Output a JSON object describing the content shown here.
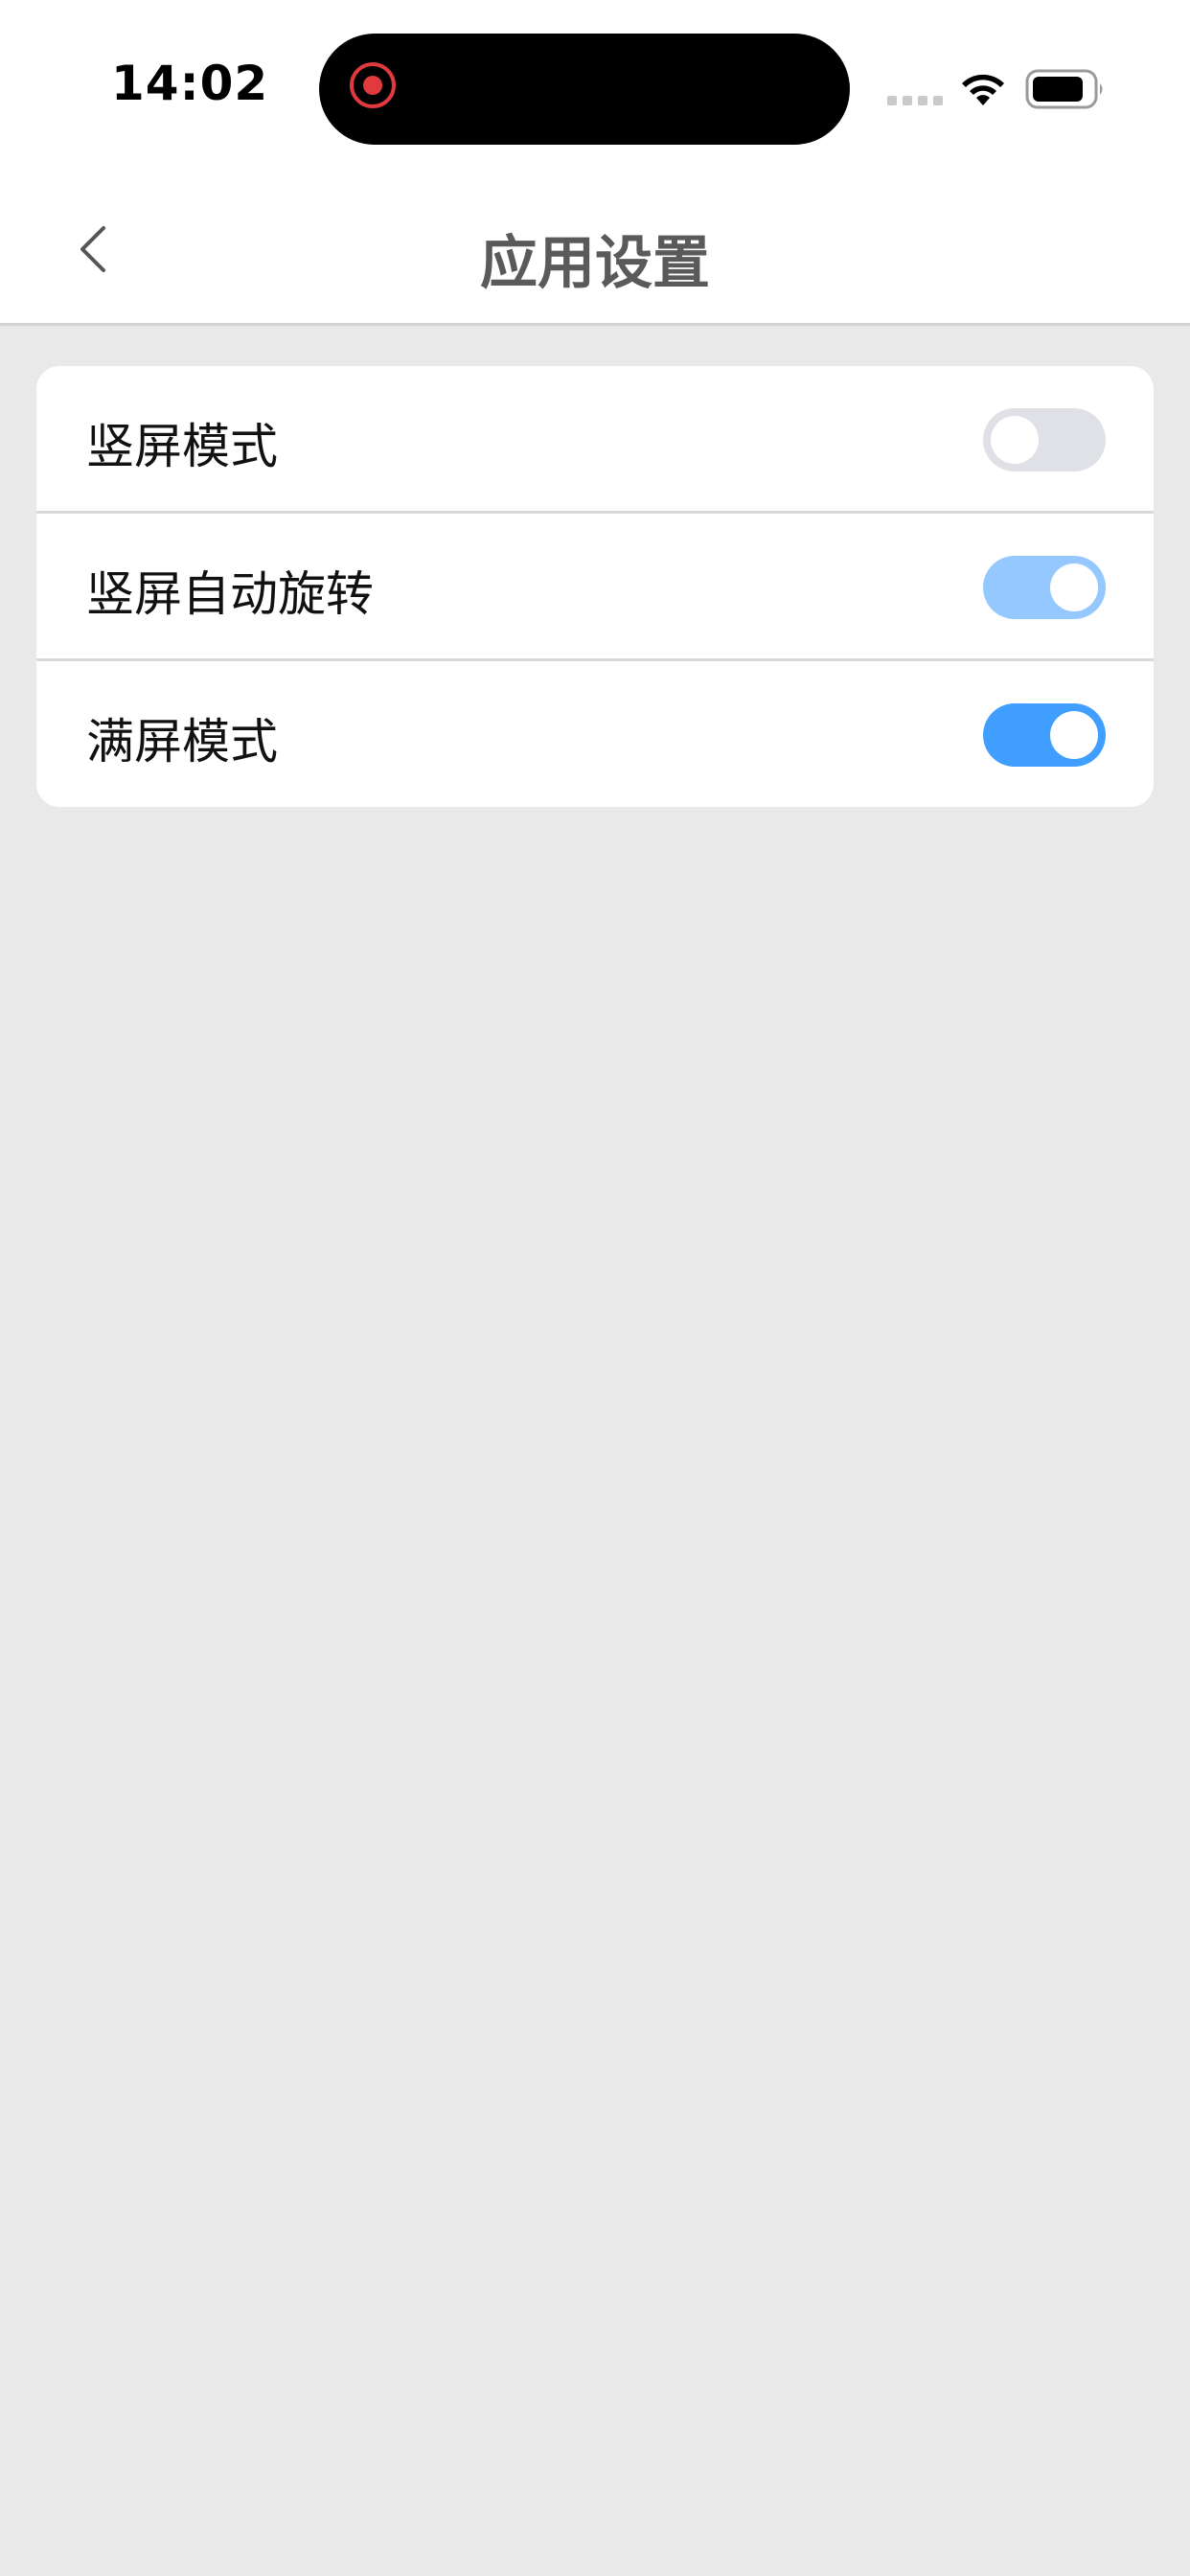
{
  "status_bar": {
    "time": "14:02",
    "icons": [
      "screen-recording-icon",
      "cellular-signal-icon",
      "wifi-icon",
      "battery-icon"
    ]
  },
  "nav": {
    "back_icon": "chevron-left-icon",
    "title": "应用设置"
  },
  "settings": [
    {
      "label": "竖屏模式",
      "enabled": false,
      "disabled": false,
      "color": "#dfe1e6"
    },
    {
      "label": "竖屏自动旋转",
      "enabled": true,
      "disabled": true,
      "color": "#94c8ff"
    },
    {
      "label": "满屏模式",
      "enabled": true,
      "disabled": false,
      "color": "#409eff"
    }
  ],
  "colors": {
    "accent": "#409eff",
    "accent_disabled": "#94c8ff",
    "toggle_off": "#dfe1e6",
    "page_background": "#e9e9e9",
    "title_text": "#5a5a5a",
    "recording": "#e03a3e"
  }
}
